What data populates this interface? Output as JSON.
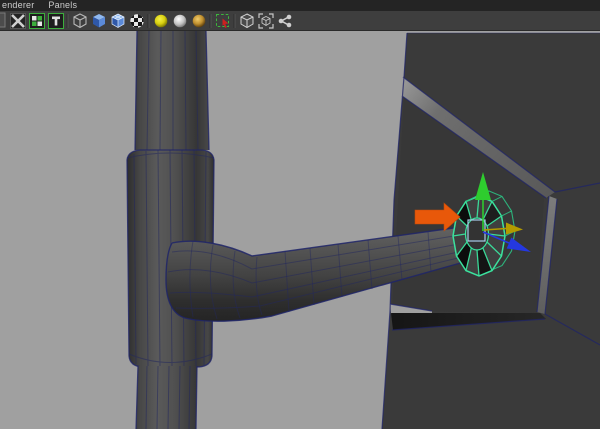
{
  "menu": {
    "items": [
      {
        "label": "enderer"
      },
      {
        "label": "Panels"
      }
    ]
  },
  "toolbar": {
    "icons": [
      "cropped-icon",
      "gate-mask-icon",
      "field-chart-icon",
      "safe-title-icon",
      "wireframe-mode-icon",
      "smooth-shade-icon",
      "wireframe-on-shaded-icon",
      "textured-mode-icon",
      "lights-icon",
      "shadows-icon",
      "ambient-occlusion-icon",
      "isolate-select-icon",
      "xray-icon",
      "xray-active-components-icon",
      "plugin-objects-icon"
    ]
  },
  "viewport": {
    "background_color": "#a0a0a0",
    "wireframe_color": "#222a6a",
    "selection_highlight_color": "#3be29e",
    "object_shade_color": "#4a4a4a",
    "wall_color": "#3a3a3a",
    "annotation_arrow_color": "#e8580a",
    "manipulator": {
      "x_axis_color": "#b39b00",
      "y_axis_color": "#2ecc2e",
      "z_axis_color": "#2438e0",
      "plane_handle_color": "#a8cce8"
    },
    "objects": [
      "vertical-pipe",
      "pipe-coupling-sleeve",
      "branch-elbow-pipe",
      "selected-flange-ring",
      "wall-with-opening"
    ]
  }
}
